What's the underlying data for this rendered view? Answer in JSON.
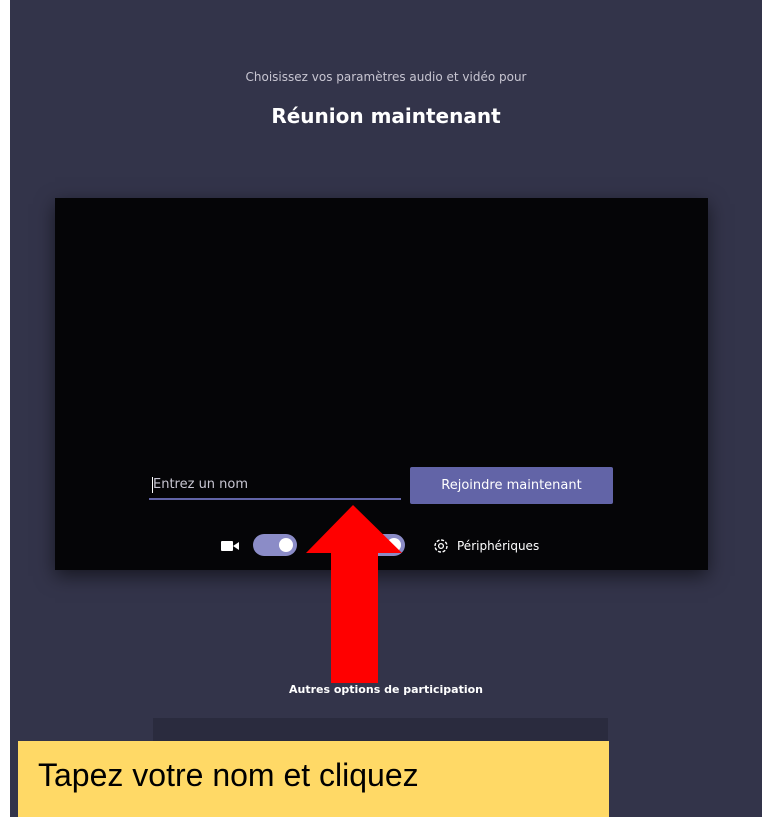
{
  "header": {
    "subtitle": "Choisissez vos paramètres audio et vidéo pour",
    "title": "Réunion maintenant"
  },
  "prejoin": {
    "name_placeholder": "Entrez un nom",
    "name_value": "",
    "join_label": "Rejoindre maintenant",
    "video_toggle_on": true,
    "audio_toggle_on": true,
    "devices_label": "Périphériques"
  },
  "other_options": {
    "label": "Autres options de participation"
  },
  "annotation": {
    "callout_text": "Tapez votre nom et cliquez",
    "arrow_color": "#ff0000",
    "callout_color": "#ffd966"
  },
  "colors": {
    "background": "#33344a",
    "accent": "#6264a7",
    "preview": "#050507"
  },
  "icons": [
    "camera-icon",
    "microphone-icon",
    "gear-icon"
  ]
}
